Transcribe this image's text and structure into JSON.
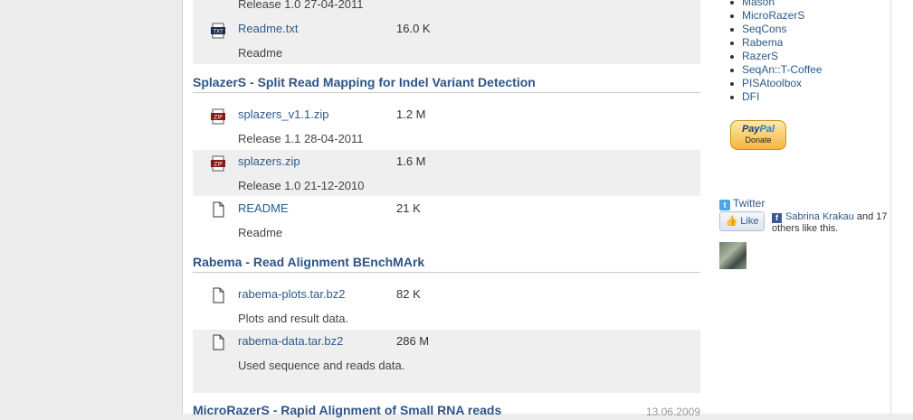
{
  "sections": [
    {
      "title": "",
      "files": [
        {
          "icon": "txt-file-icon",
          "name": "Readme.txt",
          "size": "16.0 K",
          "desc": "Readme"
        }
      ],
      "top_release": "Release 1.0 27-04-2011"
    },
    {
      "title": "SplazerS - Split Read Mapping for Indel Variant Detection",
      "files": [
        {
          "icon": "zip-file-icon",
          "name": "splazers_v1.1.zip",
          "size": "1.2 M",
          "desc": "Release 1.1 28-04-2011"
        },
        {
          "icon": "zip-file-icon",
          "name": "splazers.zip",
          "size": "1.6 M",
          "desc": "Release 1.0 21-12-2010"
        },
        {
          "icon": "blank-file-icon",
          "name": "README",
          "size": "21 K",
          "desc": "Readme"
        }
      ]
    },
    {
      "title": "Rabema - Read Alignment BEnchMArk",
      "files": [
        {
          "icon": "blank-file-icon",
          "name": "rabema-plots.tar.bz2",
          "size": "82 K",
          "desc": "Plots and result data."
        },
        {
          "icon": "blank-file-icon",
          "name": "rabema-data.tar.bz2",
          "size": "286 M",
          "desc": "Used sequence and reads data."
        }
      ]
    },
    {
      "title": "MicroRazerS - Rapid Alignment of Small RNA reads",
      "date": "13.06.2009"
    }
  ],
  "sidebar": {
    "nav": [
      "Mason",
      "MicroRazerS",
      "SeqCons",
      "Rabema",
      "RazerS",
      "SeqAn::T-Coffee",
      "PISAtoolbox",
      "DFI"
    ],
    "paypal": {
      "brand_dark": "Pay",
      "brand_light": "Pal",
      "label": "Donate"
    },
    "twitter": "Twitter",
    "like": "Like",
    "fb_user": "Sabrina Krakau",
    "fb_rest": "and 17 others like this."
  }
}
